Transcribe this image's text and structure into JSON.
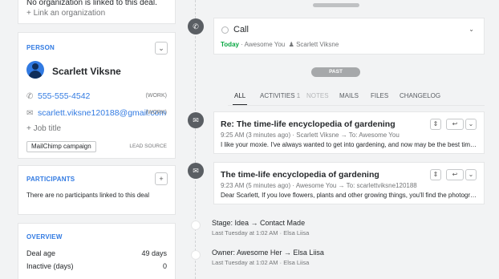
{
  "org_card": {
    "line1": "No organization is linked to this deal.",
    "link": "+ Link an organization"
  },
  "person": {
    "section_title": "PERSON",
    "name": "Scarlett Viksne",
    "phone": "555-555-4542",
    "phone_tag": "(WORK)",
    "email": "scarlett.viksne120188@gmail.com",
    "email_tag": "(WORK)",
    "add_job_title": "+ Job title",
    "campaign": "MailChimp campaign",
    "lead_source": "LEAD SOURCE"
  },
  "participants": {
    "section_title": "PARTICIPANTS",
    "add_label": "+",
    "empty": "There are no participants linked to this deal"
  },
  "overview": {
    "section_title": "OVERVIEW",
    "rows": [
      {
        "label": "Deal age",
        "value": "49 days"
      },
      {
        "label": "Inactive (days)",
        "value": "0"
      }
    ]
  },
  "call": {
    "title": "Call",
    "today": "Today",
    "sep": "·",
    "owner": "Awesome You",
    "contact": "Scarlett Viksne"
  },
  "past_label": "PAST",
  "tabs": [
    {
      "label": "ALL",
      "count": ""
    },
    {
      "label": "ACTIVITIES",
      "count": "1"
    },
    {
      "label": "NOTES",
      "count": ""
    },
    {
      "label": "MAILS",
      "count": ""
    },
    {
      "label": "FILES",
      "count": ""
    },
    {
      "label": "CHANGELOG",
      "count": ""
    }
  ],
  "mails": [
    {
      "subject": "Re: The time-life encyclopedia of gardening",
      "meta": "9:25 AM (3 minutes ago) · Scarlett Viksne → To: Awesome You",
      "body": "I like your moxie. I've always wanted to get into gardening, and now may be the best time..."
    },
    {
      "subject": "The time-life encyclopedia of gardening",
      "meta": "9:23 AM (5 minutes ago) · Awesome You → To: scarlettviksne120188",
      "body": "Dear Scarlett, If you love flowers, plants and other growing things, you'll find the photogra..."
    }
  ],
  "changes": [
    {
      "text": "Stage: Idea → Contact Made",
      "sub": "Last Tuesday at 1:02 AM  ·  Elsa Liisa"
    },
    {
      "text": "Owner: Awesome Her → Elsa Liisa",
      "sub": "Last Tuesday at 1:02 AM  ·  Elsa Liisa"
    }
  ],
  "icons": {
    "phone": "phone-icon",
    "mail": "mail-icon",
    "chevron": "chevron-down-icon",
    "reply": "reply-icon"
  }
}
